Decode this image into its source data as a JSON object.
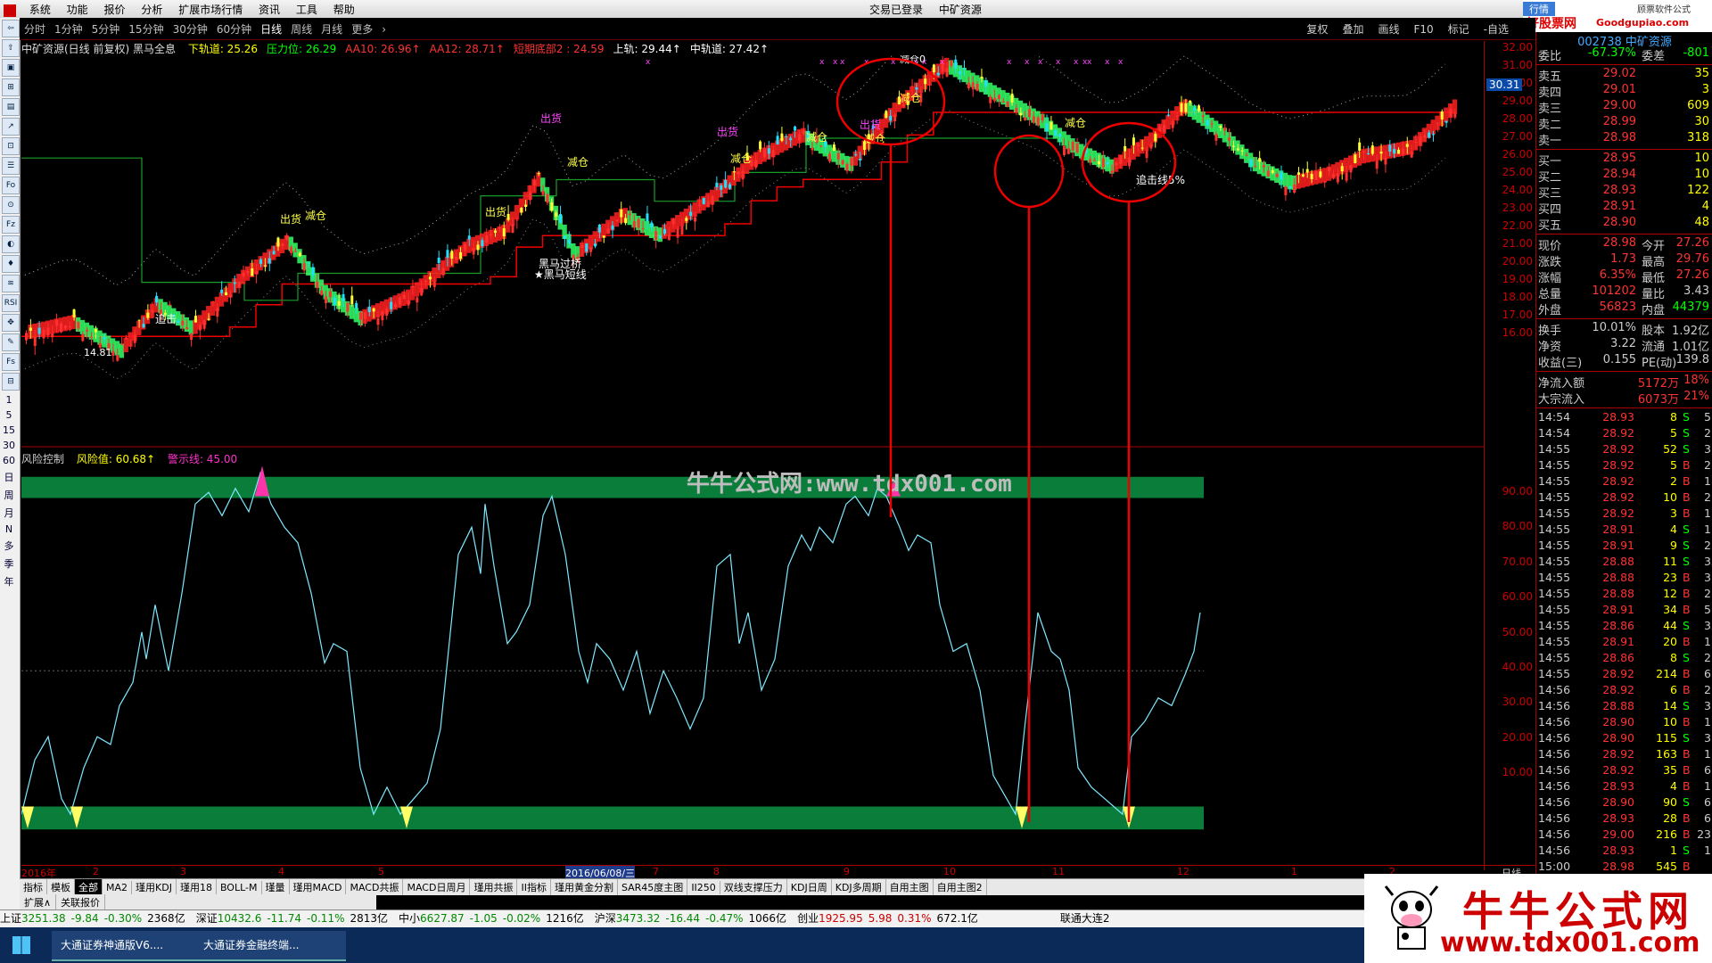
{
  "menu": {
    "items": [
      "系统",
      "功能",
      "报价",
      "分析",
      "扩展市场行情",
      "资讯",
      "工具",
      "帮助"
    ],
    "center": [
      "交易已登录",
      "中矿资源"
    ],
    "right_labels": [
      "行情",
      "好股票网",
      "Goodgupiao.com",
      "顾票软件公式"
    ]
  },
  "periods": {
    "items": [
      "分时",
      "1分钟",
      "5分钟",
      "15分钟",
      "30分钟",
      "60分钟",
      "日线",
      "周线",
      "月线",
      "更多"
    ],
    "active": "日线",
    "right_buttons": [
      "复权",
      "叠加",
      "画线",
      "F10",
      "标记",
      "-自选"
    ]
  },
  "left_toolbar": {
    "icons": [
      "⇦",
      "⇧",
      "▣",
      "⊞",
      "▤",
      "↗",
      "⊡",
      "☰",
      "Fo",
      "⊙",
      "Fz",
      "◐",
      "♦",
      "≋",
      "RSI",
      "✥",
      "✎",
      "Fs",
      "⊟"
    ],
    "periods": [
      "1",
      "5",
      "15",
      "30",
      "60",
      "日",
      "周",
      "月",
      "N",
      "多",
      "季",
      "年"
    ]
  },
  "chart_header": {
    "name": "中矿资源(日线 前复权) 黑马全息",
    "items": [
      {
        "label": "下轨道: 25.26",
        "color": "#ffff00"
      },
      {
        "label": "压力位: 26.29",
        "color": "#00ff00"
      },
      {
        "label": "AA10: 26.96↑",
        "color": "#ff3333"
      },
      {
        "label": "AA12: 28.71↑",
        "color": "#ff3333"
      },
      {
        "label": "短期底部2 : 24.59",
        "color": "#ff3333"
      },
      {
        "label": "上轨: 29.44↑",
        "color": "#ffffff"
      },
      {
        "label": "中轨道: 27.42↑",
        "color": "#ffffff"
      }
    ]
  },
  "price_axis": [
    "32.00",
    "31.00",
    "30.00",
    "29.00",
    "28.00",
    "27.00",
    "26.00",
    "25.00",
    "24.00",
    "23.00",
    "22.00",
    "21.00",
    "20.00",
    "19.00",
    "18.00",
    "17.00",
    "16.00"
  ],
  "current_price_tag": "30.31",
  "annotations": {
    "low_label": "14.81",
    "top_label": "减仓0",
    "main_texts": [
      "出货",
      "减仓",
      "出货",
      "减仓",
      "出货",
      "出货",
      "减仓",
      "减仓",
      "减仓",
      "减仓",
      "黑马过桥",
      "★黑马短线",
      "追击",
      "追击线5%",
      "出货",
      "减仓"
    ]
  },
  "indicator": {
    "name": "风险控制",
    "risk_value": "风险值: 60.68↑",
    "alert_line": "警示线: 45.00",
    "axis": [
      "90.00",
      "80.00",
      "70.00",
      "60.00",
      "50.00",
      "40.00",
      "30.00",
      "20.00",
      "10.00"
    ],
    "watermark": "牛牛公式网:www.tdx001.com"
  },
  "dates": [
    "2016年",
    "2",
    "3",
    "4",
    "5",
    "2016/06/08/三",
    "7",
    "8",
    "9",
    "10",
    "11",
    "12",
    "1",
    "2"
  ],
  "date_axis_right": "日线",
  "bottom_tabs": [
    "指标",
    "模板",
    "全部",
    "MA2",
    "瑾用KDJ",
    "瑾用18",
    "BOLL-M",
    "瑾量",
    "瑾用MACD",
    "MACD共振",
    "MACD日周月",
    "瑾用共振",
    "II指标",
    "瑾用黄金分割",
    "SAR45度主图",
    "II250",
    "双线支撑压力",
    "KDJ日周",
    "KDJ多周期",
    "自用主图",
    "自用主图2"
  ],
  "bottom_tabs_selected": "全部",
  "bottom_tabs2": [
    "扩展∧",
    "关联报价"
  ],
  "index_strip": [
    {
      "name": "上证",
      "val": "3251.38",
      "chg": "-9.84",
      "pct": "-0.30%",
      "amt": "2368亿"
    },
    {
      "name": "深证",
      "val": "10432.6",
      "chg": "-11.74",
      "pct": "-0.11%",
      "amt": "2813亿"
    },
    {
      "name": "中小",
      "val": "6627.87",
      "chg": "-1.05",
      "pct": "-0.02%",
      "amt": "1216亿"
    },
    {
      "name": "沪深",
      "val": "3473.32",
      "chg": "-16.44",
      "pct": "-0.47%",
      "amt": "1066亿"
    },
    {
      "name": "创业",
      "val": "1925.95",
      "chg": "5.98",
      "pct": "0.31%",
      "amt": "672.1亿"
    }
  ],
  "index_strip_tail": "联通大连2",
  "taskbar": [
    "大通证券神通版V6....",
    "大通证券金融终端..."
  ],
  "quote": {
    "code": "002738 中矿资源",
    "weibi": {
      "k": "委比",
      "v": "-67.37%",
      "k2": "委差",
      "v2": "-801"
    },
    "asks": [
      {
        "k": "卖五",
        "p": "29.02",
        "v": "35"
      },
      {
        "k": "卖四",
        "p": "29.01",
        "v": "3"
      },
      {
        "k": "卖三",
        "p": "29.00",
        "v": "609"
      },
      {
        "k": "卖二",
        "p": "28.99",
        "v": "30"
      },
      {
        "k": "卖一",
        "p": "28.98",
        "v": "318"
      }
    ],
    "bids": [
      {
        "k": "买一",
        "p": "28.95",
        "v": "10"
      },
      {
        "k": "买二",
        "p": "28.94",
        "v": "10"
      },
      {
        "k": "买三",
        "p": "28.93",
        "v": "122"
      },
      {
        "k": "买四",
        "p": "28.91",
        "v": "4"
      },
      {
        "k": "买五",
        "p": "28.90",
        "v": "48"
      }
    ],
    "stats": [
      {
        "k": "现价",
        "v": "28.98",
        "k2": "今开",
        "v2": "27.26"
      },
      {
        "k": "涨跌",
        "v": "1.73",
        "k2": "最高",
        "v2": "29.76"
      },
      {
        "k": "涨幅",
        "v": "6.35%",
        "k2": "最低",
        "v2": "27.26"
      },
      {
        "k": "总量",
        "v": "101202",
        "k2": "量比",
        "v2": "3.43"
      },
      {
        "k": "外盘",
        "v": "56823",
        "k2": "内盘",
        "v2": "44379"
      }
    ],
    "stats2": [
      {
        "k": "换手",
        "v": "10.01%",
        "k2": "股本",
        "v2": "1.92亿"
      },
      {
        "k": "净资",
        "v": "3.22",
        "k2": "流通",
        "v2": "1.01亿"
      },
      {
        "k": "收益(三)",
        "v": "0.155",
        "k2": "PE(动)",
        "v2": "139.8"
      }
    ],
    "flows": [
      {
        "k": "净流入额",
        "v": "5172万",
        "p": "18%"
      },
      {
        "k": "大宗流入",
        "v": "6073万",
        "p": "21%"
      }
    ],
    "ticks": [
      [
        "14:54",
        "28.93",
        "8",
        "S",
        "5"
      ],
      [
        "14:54",
        "28.92",
        "5",
        "S",
        "2"
      ],
      [
        "14:55",
        "28.92",
        "52",
        "S",
        "3"
      ],
      [
        "14:55",
        "28.92",
        "5",
        "B",
        "2"
      ],
      [
        "14:55",
        "28.92",
        "2",
        "B",
        "1"
      ],
      [
        "14:55",
        "28.92",
        "10",
        "B",
        "2"
      ],
      [
        "14:55",
        "28.92",
        "3",
        "B",
        "1"
      ],
      [
        "14:55",
        "28.91",
        "4",
        "S",
        "1"
      ],
      [
        "14:55",
        "28.91",
        "9",
        "S",
        "2"
      ],
      [
        "14:55",
        "28.88",
        "11",
        "S",
        "3"
      ],
      [
        "14:55",
        "28.88",
        "23",
        "B",
        "3"
      ],
      [
        "14:55",
        "28.88",
        "12",
        "B",
        "2"
      ],
      [
        "14:55",
        "28.91",
        "34",
        "B",
        "5"
      ],
      [
        "14:55",
        "28.86",
        "44",
        "S",
        "3"
      ],
      [
        "14:55",
        "28.91",
        "20",
        "B",
        "1"
      ],
      [
        "14:55",
        "28.86",
        "8",
        "S",
        "2"
      ],
      [
        "14:55",
        "28.92",
        "214",
        "B",
        "6"
      ],
      [
        "14:56",
        "28.92",
        "6",
        "B",
        "2"
      ],
      [
        "14:56",
        "28.88",
        "14",
        "S",
        "3"
      ],
      [
        "14:56",
        "28.90",
        "10",
        "B",
        "1"
      ],
      [
        "14:56",
        "28.90",
        "115",
        "S",
        "3"
      ],
      [
        "14:56",
        "28.92",
        "163",
        "B",
        "1"
      ],
      [
        "14:56",
        "28.92",
        "35",
        "B",
        "6"
      ],
      [
        "14:56",
        "28.93",
        "4",
        "B",
        "1"
      ],
      [
        "14:56",
        "28.90",
        "90",
        "S",
        "6"
      ],
      [
        "14:56",
        "28.93",
        "28",
        "B",
        "6"
      ],
      [
        "14:56",
        "29.00",
        "216",
        "B",
        "23"
      ],
      [
        "14:56",
        "28.93",
        "1",
        "S",
        "1"
      ],
      [
        "15:00",
        "28.98",
        "545",
        "B",
        ""
      ]
    ]
  },
  "logo": {
    "title": "牛牛公式网",
    "url": "www.tdx001.com"
  },
  "colors": {
    "up": "#ff3333",
    "down": "#00e0e0",
    "axis": "#cc0000",
    "green_band": "#0a7d3a",
    "yellow": "#ffff66",
    "magenta": "#ff33aa"
  }
}
